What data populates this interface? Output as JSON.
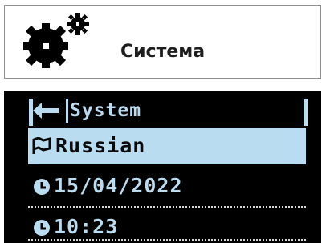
{
  "header": {
    "title": "Система",
    "icon": "gears-icon"
  },
  "screen": {
    "title": "System",
    "back_icon": "arrow-left-icon",
    "items": [
      {
        "icon": "flag-icon",
        "label": "Russian",
        "selected": true
      },
      {
        "icon": "clock-icon",
        "label": "15/04/2022",
        "selected": false
      },
      {
        "icon": "clock-icon",
        "label": "10:23",
        "selected": false
      }
    ]
  },
  "colors": {
    "screen_bg": "#000000",
    "text_light": "#b9dcf0",
    "highlight": "#b9dcf0",
    "header_text": "#1e1e1e",
    "header_border": "#8f8f8f"
  }
}
